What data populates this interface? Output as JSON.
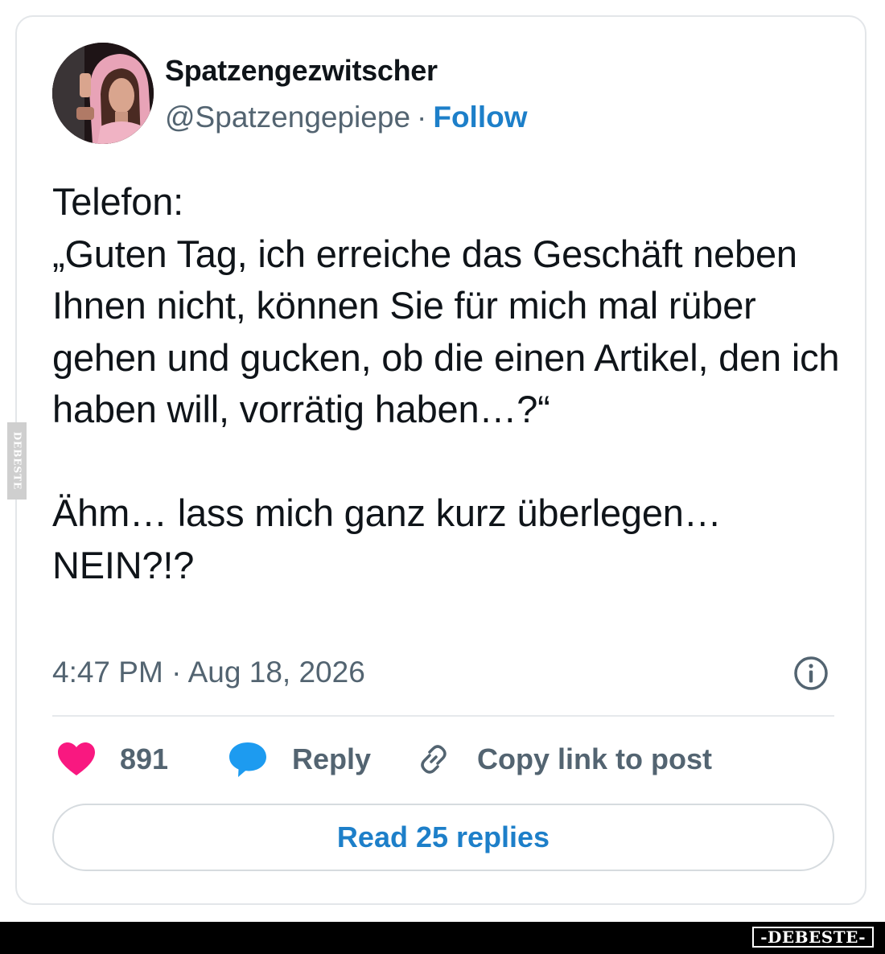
{
  "author": {
    "display_name": "Spatzengezwitscher",
    "handle": "@Spatzengepiepe",
    "separator": "·",
    "follow_label": "Follow"
  },
  "tweet": {
    "text": "Telefon:\n„Guten Tag, ich erreiche das Geschäft neben Ihnen nicht, können Sie für mich mal rüber gehen und gucken, ob die einen Artikel, den ich haben will, vorrätig haben…?“\n\nÄhm… lass mich ganz kurz überlegen… NEIN?!?",
    "timestamp": "4:47 PM · Aug 18, 2026"
  },
  "actions": {
    "like_count": "891",
    "reply_label": "Reply",
    "copy_link_label": "Copy link to post",
    "read_replies_label": "Read 25 replies"
  },
  "icons": {
    "info": "info-circle-icon",
    "like": "heart-icon",
    "reply": "speech-bubble-icon",
    "copy": "link-icon"
  },
  "watermark": {
    "side_text": "DEBESTE",
    "bottom_text": "-DEBESTE-"
  },
  "colors": {
    "heart": "#f91880",
    "reply_bubble": "#1d9bf0",
    "link_blue": "#1d7fc9",
    "muted_text": "#536471"
  }
}
